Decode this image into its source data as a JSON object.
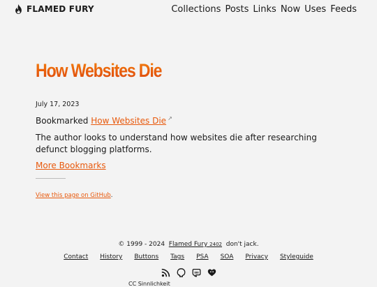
{
  "header": {
    "brand": "FLAMED FURY",
    "nav": [
      "Collections",
      "Posts",
      "Links",
      "Now",
      "Uses",
      "Feeds"
    ]
  },
  "post": {
    "title": "How Websites Die",
    "date": "July 17, 2023",
    "bookmarked_prefix": "Bookmarked",
    "bookmarked_link": "How Websites Die",
    "description": "The author looks to understand how websites die after researching defunct blogging platforms.",
    "more_link": "More Bookmarks",
    "github_link": "View this page on GitHub",
    "github_suffix": "."
  },
  "footer": {
    "copyright_prefix": "© 1999 - 2024",
    "site_name": "Flamed Fury",
    "version": "2402",
    "tagline": "don't jack.",
    "links": [
      "Contact",
      "History",
      "Buttons",
      "Tags",
      "PSA",
      "SOA",
      "Privacy",
      "Styleguide"
    ],
    "icons": [
      "rss-icon",
      "github-icon",
      "mastodon-icon",
      "heart-icon"
    ],
    "license": "CC Sinnlichkeit"
  },
  "colors": {
    "accent": "#e8590c",
    "background": "#f3f3f3",
    "text": "#1a1a1a"
  }
}
